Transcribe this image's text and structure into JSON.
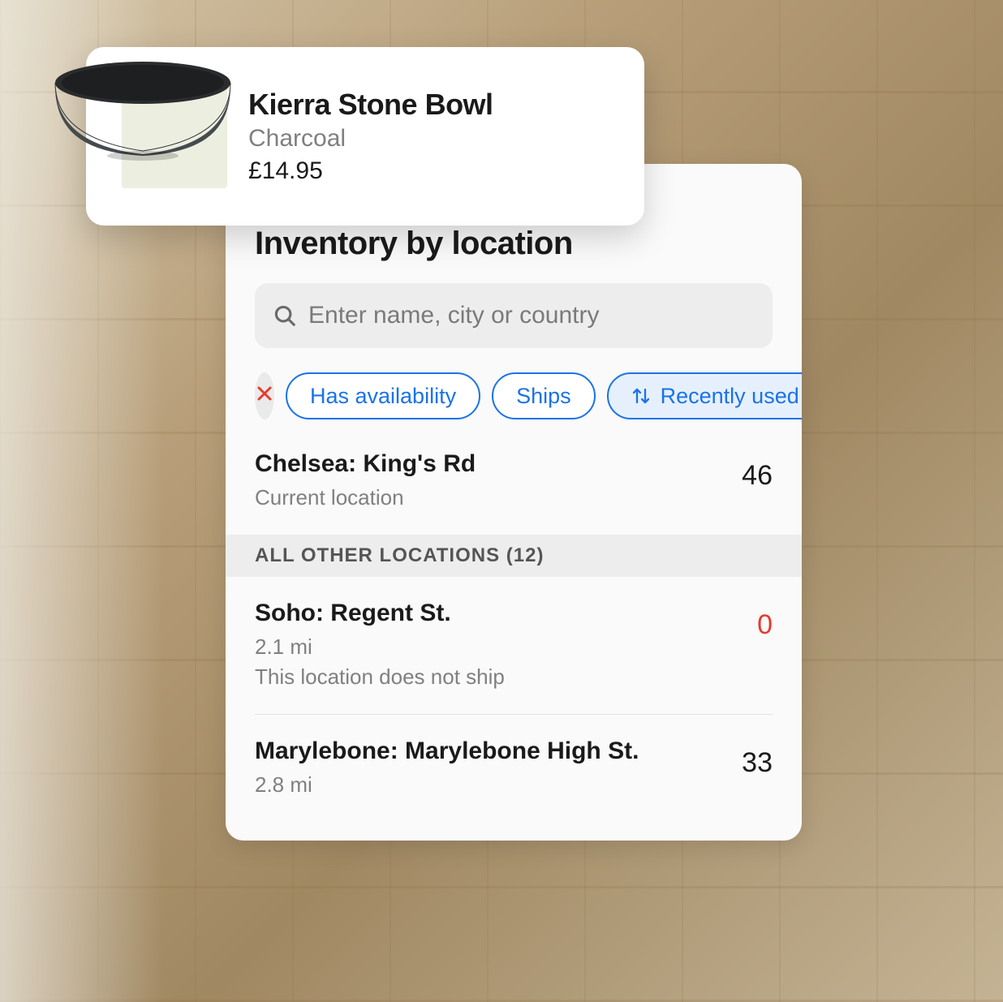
{
  "product": {
    "name": "Kierra Stone Bowl",
    "variant": "Charcoal",
    "price": "£14.95"
  },
  "inventory": {
    "title": "Inventory by location",
    "search_placeholder": "Enter name, city or country",
    "filters": {
      "availability": "Has availability",
      "ships": "Ships",
      "sort": "Recently used"
    },
    "current_location": {
      "name": "Chelsea: King's Rd",
      "subtitle": "Current location",
      "count": "46"
    },
    "other_section_label": "ALL OTHER LOCATIONS (12)",
    "other_locations": [
      {
        "name": "Soho: Regent St.",
        "distance": "2.1 mi",
        "note": "This location does not ship",
        "count": "0",
        "zero": true
      },
      {
        "name": "Marylebone: Marylebone High St.",
        "distance": "2.8 mi",
        "note": "",
        "count": "33",
        "zero": false
      }
    ]
  }
}
